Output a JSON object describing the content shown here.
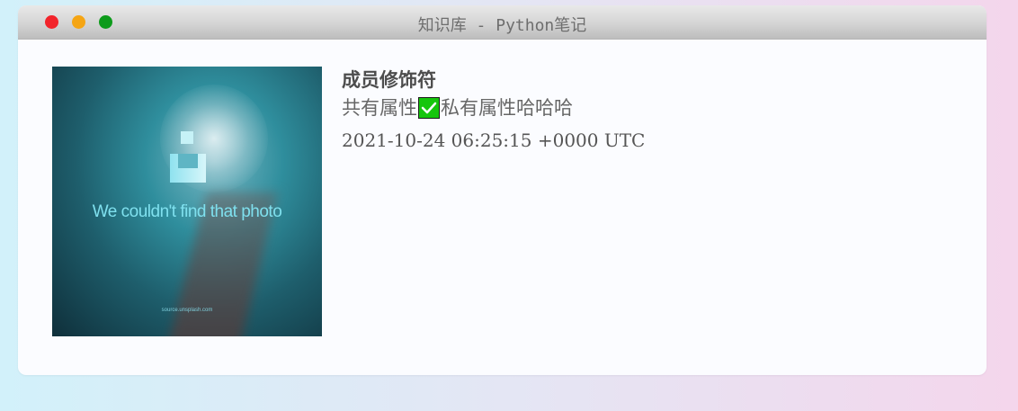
{
  "window": {
    "title": "知识库 - Python笔记",
    "colors": {
      "close": "#f2242b",
      "minimize": "#f5a514",
      "maximize": "#0d9b1b"
    }
  },
  "entry": {
    "image": {
      "message": "We couldn't find that photo",
      "source": "source.unsplash.com"
    },
    "name": "成员修饰符",
    "desc_before": "共有属性",
    "desc_icon": "check-mark-icon",
    "desc_after": "私有属性哈哈哈",
    "date": "2021-10-24 06:25:15 +0000 UTC"
  }
}
